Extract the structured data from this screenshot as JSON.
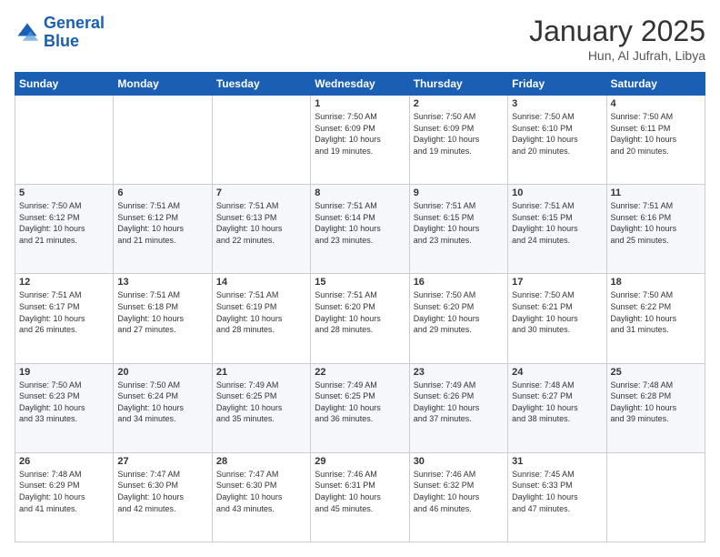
{
  "header": {
    "logo_line1": "General",
    "logo_line2": "Blue",
    "month": "January 2025",
    "location": "Hun, Al Jufrah, Libya"
  },
  "weekdays": [
    "Sunday",
    "Monday",
    "Tuesday",
    "Wednesday",
    "Thursday",
    "Friday",
    "Saturday"
  ],
  "weeks": [
    [
      {
        "day": "",
        "info": ""
      },
      {
        "day": "",
        "info": ""
      },
      {
        "day": "",
        "info": ""
      },
      {
        "day": "1",
        "info": "Sunrise: 7:50 AM\nSunset: 6:09 PM\nDaylight: 10 hours\nand 19 minutes."
      },
      {
        "day": "2",
        "info": "Sunrise: 7:50 AM\nSunset: 6:09 PM\nDaylight: 10 hours\nand 19 minutes."
      },
      {
        "day": "3",
        "info": "Sunrise: 7:50 AM\nSunset: 6:10 PM\nDaylight: 10 hours\nand 20 minutes."
      },
      {
        "day": "4",
        "info": "Sunrise: 7:50 AM\nSunset: 6:11 PM\nDaylight: 10 hours\nand 20 minutes."
      }
    ],
    [
      {
        "day": "5",
        "info": "Sunrise: 7:50 AM\nSunset: 6:12 PM\nDaylight: 10 hours\nand 21 minutes."
      },
      {
        "day": "6",
        "info": "Sunrise: 7:51 AM\nSunset: 6:12 PM\nDaylight: 10 hours\nand 21 minutes."
      },
      {
        "day": "7",
        "info": "Sunrise: 7:51 AM\nSunset: 6:13 PM\nDaylight: 10 hours\nand 22 minutes."
      },
      {
        "day": "8",
        "info": "Sunrise: 7:51 AM\nSunset: 6:14 PM\nDaylight: 10 hours\nand 23 minutes."
      },
      {
        "day": "9",
        "info": "Sunrise: 7:51 AM\nSunset: 6:15 PM\nDaylight: 10 hours\nand 23 minutes."
      },
      {
        "day": "10",
        "info": "Sunrise: 7:51 AM\nSunset: 6:15 PM\nDaylight: 10 hours\nand 24 minutes."
      },
      {
        "day": "11",
        "info": "Sunrise: 7:51 AM\nSunset: 6:16 PM\nDaylight: 10 hours\nand 25 minutes."
      }
    ],
    [
      {
        "day": "12",
        "info": "Sunrise: 7:51 AM\nSunset: 6:17 PM\nDaylight: 10 hours\nand 26 minutes."
      },
      {
        "day": "13",
        "info": "Sunrise: 7:51 AM\nSunset: 6:18 PM\nDaylight: 10 hours\nand 27 minutes."
      },
      {
        "day": "14",
        "info": "Sunrise: 7:51 AM\nSunset: 6:19 PM\nDaylight: 10 hours\nand 28 minutes."
      },
      {
        "day": "15",
        "info": "Sunrise: 7:51 AM\nSunset: 6:20 PM\nDaylight: 10 hours\nand 28 minutes."
      },
      {
        "day": "16",
        "info": "Sunrise: 7:50 AM\nSunset: 6:20 PM\nDaylight: 10 hours\nand 29 minutes."
      },
      {
        "day": "17",
        "info": "Sunrise: 7:50 AM\nSunset: 6:21 PM\nDaylight: 10 hours\nand 30 minutes."
      },
      {
        "day": "18",
        "info": "Sunrise: 7:50 AM\nSunset: 6:22 PM\nDaylight: 10 hours\nand 31 minutes."
      }
    ],
    [
      {
        "day": "19",
        "info": "Sunrise: 7:50 AM\nSunset: 6:23 PM\nDaylight: 10 hours\nand 33 minutes."
      },
      {
        "day": "20",
        "info": "Sunrise: 7:50 AM\nSunset: 6:24 PM\nDaylight: 10 hours\nand 34 minutes."
      },
      {
        "day": "21",
        "info": "Sunrise: 7:49 AM\nSunset: 6:25 PM\nDaylight: 10 hours\nand 35 minutes."
      },
      {
        "day": "22",
        "info": "Sunrise: 7:49 AM\nSunset: 6:25 PM\nDaylight: 10 hours\nand 36 minutes."
      },
      {
        "day": "23",
        "info": "Sunrise: 7:49 AM\nSunset: 6:26 PM\nDaylight: 10 hours\nand 37 minutes."
      },
      {
        "day": "24",
        "info": "Sunrise: 7:48 AM\nSunset: 6:27 PM\nDaylight: 10 hours\nand 38 minutes."
      },
      {
        "day": "25",
        "info": "Sunrise: 7:48 AM\nSunset: 6:28 PM\nDaylight: 10 hours\nand 39 minutes."
      }
    ],
    [
      {
        "day": "26",
        "info": "Sunrise: 7:48 AM\nSunset: 6:29 PM\nDaylight: 10 hours\nand 41 minutes."
      },
      {
        "day": "27",
        "info": "Sunrise: 7:47 AM\nSunset: 6:30 PM\nDaylight: 10 hours\nand 42 minutes."
      },
      {
        "day": "28",
        "info": "Sunrise: 7:47 AM\nSunset: 6:30 PM\nDaylight: 10 hours\nand 43 minutes."
      },
      {
        "day": "29",
        "info": "Sunrise: 7:46 AM\nSunset: 6:31 PM\nDaylight: 10 hours\nand 45 minutes."
      },
      {
        "day": "30",
        "info": "Sunrise: 7:46 AM\nSunset: 6:32 PM\nDaylight: 10 hours\nand 46 minutes."
      },
      {
        "day": "31",
        "info": "Sunrise: 7:45 AM\nSunset: 6:33 PM\nDaylight: 10 hours\nand 47 minutes."
      },
      {
        "day": "",
        "info": ""
      }
    ]
  ]
}
